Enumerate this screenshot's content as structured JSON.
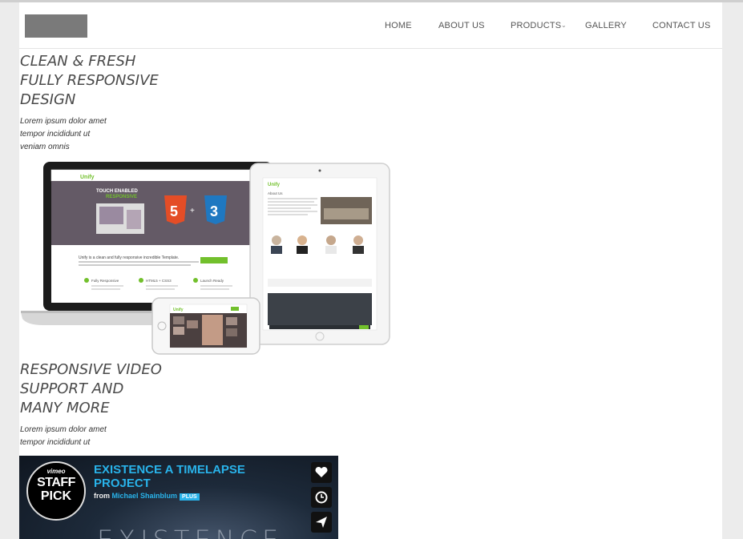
{
  "nav": {
    "home": "HOME",
    "about": "ABOUT US",
    "products": "PRODUCTS",
    "gallery": "GALLERY",
    "contact": "CONTACT US"
  },
  "section1": {
    "heading_lines": [
      "CLEAN & FRESH",
      "FULLY RESPONSIVE",
      "DESIGN"
    ],
    "body_lines": [
      "Lorem ipsum dolor amet",
      "tempor incididunt ut",
      "veniam omnis"
    ]
  },
  "mockup": {
    "brand": "Unify",
    "laptop_headline_1": "TOUCH ENABLED",
    "laptop_headline_2": "RESPONSIVE",
    "html_badge": "5",
    "css_badge": "3",
    "plus": "+",
    "tagline": "Unify is a clean and fully responsive incredible Template.",
    "feature1": "Fully Responsive",
    "feature2": "HTML5 + CSS3",
    "feature3": "Launch Ready",
    "tablet_heading": "About Us",
    "colors": {
      "accent": "#72c02c",
      "html5": "#e44d26",
      "css3": "#1f78c1"
    }
  },
  "section2": {
    "heading_lines": [
      "RESPONSIVE VIDEO",
      "SUPPORT AND",
      "MANY MORE"
    ],
    "body_lines": [
      "Lorem ipsum dolor amet",
      "tempor incididunt ut"
    ]
  },
  "video": {
    "title": "EXISTENCE A TIMELAPSE PROJECT",
    "from": "from",
    "author": "Michael Shainblum",
    "plus_badge": "PLUS",
    "badge_top": "vimeo",
    "badge_line1": "STAFF",
    "badge_line2": "PICK",
    "big_text": "EXISTENCE",
    "icons": [
      "heart-icon",
      "clock-icon",
      "send-icon"
    ],
    "colors": {
      "title": "#29b3ea"
    }
  }
}
